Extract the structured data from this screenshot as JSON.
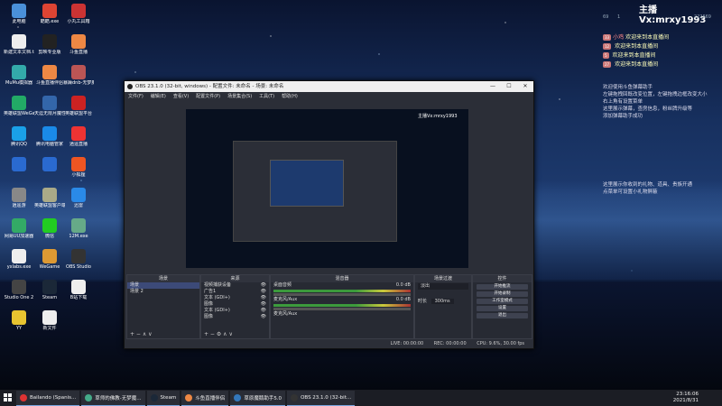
{
  "desktop": {
    "icons": [
      {
        "label": "此电脑",
        "color": "#4a90d9"
      },
      {
        "label": "酷酷.exe",
        "color": "#d43"
      },
      {
        "label": "小丸工具箱",
        "color": "#c33"
      },
      {
        "label": "新建文本文档.txt",
        "color": "#eee"
      },
      {
        "label": "剪映专业版",
        "color": "#222"
      },
      {
        "label": "斗鱼直播",
        "color": "#e84"
      },
      {
        "label": "MuMu模拟器",
        "color": "#3aa"
      },
      {
        "label": "斗鱼直播伴侣",
        "color": "#e84"
      },
      {
        "label": "暴躁dnb-无梦魔改.rar",
        "color": "#b55"
      },
      {
        "label": "英雄联盟WeGame版",
        "color": "#2a6"
      },
      {
        "label": "天涯无限月魔性升级",
        "color": "#36a"
      },
      {
        "label": "英雄联盟平台",
        "color": "#c22"
      },
      {
        "label": "腾讯QQ",
        "color": "#1aa0e8"
      },
      {
        "label": "腾讯电脑管家",
        "color": "#1a8ae8"
      },
      {
        "label": "逍遥直播",
        "color": "#e33"
      },
      {
        "label": "",
        "color": "#2a6ad0"
      },
      {
        "label": "",
        "color": "#2a6ad0"
      },
      {
        "label": "小狐狸",
        "color": "#e52"
      },
      {
        "label": "逍遥游",
        "color": "#888"
      },
      {
        "label": "英雄联盟客户端",
        "color": "#aa8"
      },
      {
        "label": "迅雷",
        "color": "#2a8ae8"
      },
      {
        "label": "网易UU加速器",
        "color": "#3a6"
      },
      {
        "label": "微信",
        "color": "#2c2"
      },
      {
        "label": "12M.exe",
        "color": "#6a8"
      },
      {
        "label": "yxlabs.exe",
        "color": "#eee"
      },
      {
        "label": "WeGame",
        "color": "#d93"
      },
      {
        "label": "OBS Studio",
        "color": "#333"
      },
      {
        "label": "Studio One 2",
        "color": "#444"
      },
      {
        "label": "Steam",
        "color": "#1b2838"
      },
      {
        "label": "B站下载",
        "color": "#eee"
      },
      {
        "label": "YY",
        "color": "#e8c430"
      },
      {
        "label": "新文件",
        "color": "#eee"
      }
    ]
  },
  "chat": {
    "streamer_title": "主播Vx:mrxy1993",
    "stat1": "69",
    "stat2": "1",
    "stat3": "222669",
    "messages": [
      {
        "badge": "33",
        "name": "小鸡",
        "text": "欢迎来到本直播间"
      },
      {
        "badge": "12",
        "name": "",
        "text": "欢迎来到本直播间"
      },
      {
        "badge": "5",
        "name": "",
        "text": "欢迎来到本直播间"
      },
      {
        "badge": "27",
        "name": "",
        "text": "欢迎来到本直播间"
      }
    ],
    "system_lines": [
      "欢迎使用斗鱼弹幕助手",
      "左键拖拽回既改变位置，左键拖拽边框改变大小",
      "右上角有设置菜单",
      "这里展示弹幕，查房信息，粉丝牌升级等",
      "添加弹幕助手成功",
      "这里展示你收到的礼物、道具、贵族开通",
      "点菜单可设置小礼物屏蔽"
    ]
  },
  "obs": {
    "title": "OBS 23.1.0 (32-bit, windows) - 配置文件: 未命名 - 场景: 未命名",
    "menu": [
      "文件(F)",
      "编辑(E)",
      "查看(V)",
      "配置文件(P)",
      "场景集合(S)",
      "工具(T)",
      "帮助(H)"
    ],
    "preview_chat_title": "主播Vx:mrxy1993",
    "docks": {
      "scenes": {
        "header": "场景",
        "items": [
          "场景",
          "场景 2"
        ]
      },
      "sources": {
        "header": "来源",
        "items": [
          "视频捕获设备",
          "广告1",
          "文本 (GDI+)",
          "图像",
          "文本 (GDI+)",
          "图像"
        ]
      },
      "mixer": {
        "header": "混音器",
        "ch1": "桌面音频",
        "ch1_db": "0.0 dB",
        "ch2": "麦克风/Aux",
        "ch2_db": "0.0 dB",
        "ch3": "麦克风/Aux"
      },
      "transitions": {
        "header": "场景过渡",
        "type": "淡出",
        "duration_label": "时长",
        "duration": "300ms"
      },
      "controls": {
        "header": "控件",
        "buttons": [
          "开始推流",
          "开始录制",
          "工作室模式",
          "设置",
          "退出"
        ]
      }
    },
    "status": {
      "live": "LIVE: 00:00:00",
      "rec": "REC: 00:00:00",
      "cpu": "CPU: 9.6%, 30.00 fps"
    }
  },
  "taskbar": {
    "items": [
      {
        "label": "Bailando (Spanis...",
        "color": "#d33"
      },
      {
        "label": "草师的佛教-无梦魔...",
        "color": "#4a8"
      },
      {
        "label": "Steam",
        "color": "#1b2838"
      },
      {
        "label": "斗鱼直播伴侣",
        "color": "#e84"
      },
      {
        "label": "草原魔鹅助手5.0",
        "color": "#37b"
      },
      {
        "label": "OBS 23.1.0 (32-bit...",
        "color": "#333"
      }
    ],
    "time": "23:16:06",
    "date": "2021/8/31"
  }
}
